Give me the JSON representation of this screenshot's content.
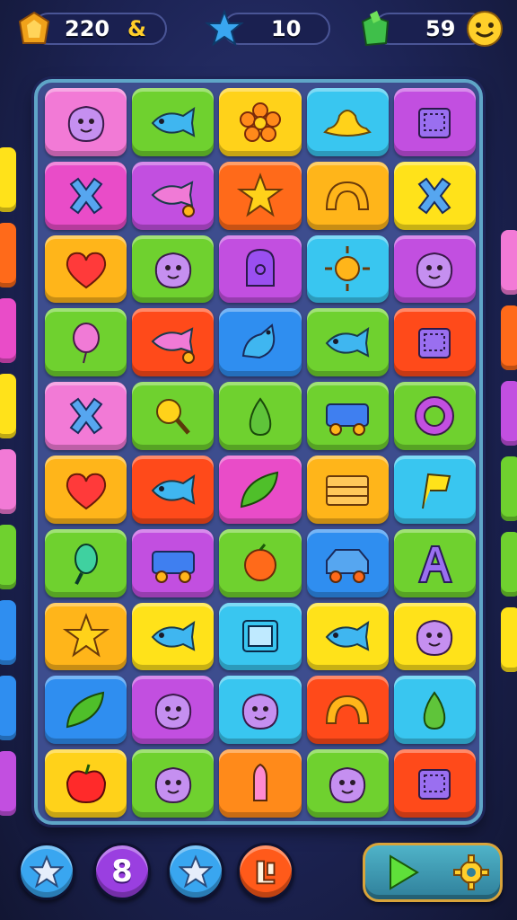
{
  "hud": {
    "coins": {
      "value": "220",
      "suffix": "&"
    },
    "stars": {
      "value": "10"
    },
    "moves": {
      "value": "59"
    }
  },
  "board": {
    "rows": [
      [
        {
          "color": "#f27ad6",
          "icon": "blob-face"
        },
        {
          "color": "#6fd12f",
          "icon": "fish"
        },
        {
          "color": "#ffd21a",
          "icon": "flower"
        },
        {
          "color": "#39c6f0",
          "icon": "hat"
        },
        {
          "color": "#c24fe0",
          "icon": "box"
        }
      ],
      [
        {
          "color": "#e94cc8",
          "icon": "cross"
        },
        {
          "color": "#c24fe0",
          "icon": "fish-cart"
        },
        {
          "color": "#ff6a1a",
          "icon": "star"
        },
        {
          "color": "#ffb51a",
          "icon": "rainbow"
        },
        {
          "color": "#ffe21a",
          "icon": "cross"
        }
      ],
      [
        {
          "color": "#ffb51a",
          "icon": "heart"
        },
        {
          "color": "#6fd12f",
          "icon": "blob-face"
        },
        {
          "color": "#c24fe0",
          "icon": "tombstone"
        },
        {
          "color": "#39c6f0",
          "icon": "sun"
        },
        {
          "color": "#c24fe0",
          "icon": "blob-face"
        }
      ],
      [
        {
          "color": "#6fd12f",
          "icon": "balloon"
        },
        {
          "color": "#ff4a1a",
          "icon": "fish-cart"
        },
        {
          "color": "#2f8ef0",
          "icon": "bird"
        },
        {
          "color": "#6fd12f",
          "icon": "fish"
        },
        {
          "color": "#ff4a1a",
          "icon": "box"
        }
      ],
      [
        {
          "color": "#f27ad6",
          "icon": "cross"
        },
        {
          "color": "#6fd12f",
          "icon": "magnifier"
        },
        {
          "color": "#6fd12f",
          "icon": "pear"
        },
        {
          "color": "#6fd12f",
          "icon": "cart"
        },
        {
          "color": "#6fd12f",
          "icon": "ring"
        }
      ],
      [
        {
          "color": "#ffb51a",
          "icon": "heart"
        },
        {
          "color": "#ff4a1a",
          "icon": "fish"
        },
        {
          "color": "#e94cc8",
          "icon": "leaf"
        },
        {
          "color": "#ffb51a",
          "icon": "crate"
        },
        {
          "color": "#39c6f0",
          "icon": "flag"
        }
      ],
      [
        {
          "color": "#6fd12f",
          "icon": "mirror"
        },
        {
          "color": "#c24fe0",
          "icon": "cart"
        },
        {
          "color": "#6fd12f",
          "icon": "orange"
        },
        {
          "color": "#2f8ef0",
          "icon": "car"
        },
        {
          "color": "#6fd12f",
          "icon": "letter-a"
        }
      ],
      [
        {
          "color": "#ffb51a",
          "icon": "star"
        },
        {
          "color": "#ffe21a",
          "icon": "fish"
        },
        {
          "color": "#39c6f0",
          "icon": "frame"
        },
        {
          "color": "#ffe21a",
          "icon": "fish"
        },
        {
          "color": "#ffe21a",
          "icon": "blob-face"
        }
      ],
      [
        {
          "color": "#2f8ef0",
          "icon": "leaf"
        },
        {
          "color": "#c24fe0",
          "icon": "blob-face"
        },
        {
          "color": "#39c6f0",
          "icon": "blob-face"
        },
        {
          "color": "#ff4a1a",
          "icon": "rainbow"
        },
        {
          "color": "#39c6f0",
          "icon": "pear"
        }
      ],
      [
        {
          "color": "#ffd21a",
          "icon": "apple"
        },
        {
          "color": "#6fd12f",
          "icon": "blob-face"
        },
        {
          "color": "#ff8a1a",
          "icon": "tube"
        },
        {
          "color": "#6fd12f",
          "icon": "blob-face"
        },
        {
          "color": "#ff4a1a",
          "icon": "box"
        }
      ]
    ]
  },
  "side_tiles": {
    "left": [
      "#ffe21a",
      "#ff6a1a",
      "#e94cc8",
      "#ffe21a",
      "#f27ad6",
      "#6fd12f",
      "#2f8ef0",
      "#2f8ef0",
      "#c24fe0"
    ],
    "right": [
      "#f27ad6",
      "#ff6a1a",
      "#c24fe0",
      "#6fd12f",
      "#6fd12f",
      "#ffe21a"
    ]
  },
  "bottom_bar": {
    "star_button_1": {
      "color": "#39a6f0"
    },
    "moves_counter": {
      "value": "8",
      "color": "#9a3fe0"
    },
    "star_button_2": {
      "color": "#39a6f0"
    },
    "booster_button": {
      "color": "#ff5a1a"
    }
  },
  "icon_names": {
    "coin": "coin-icon",
    "star": "star-icon",
    "bonus": "gift-icon",
    "smiley": "smiley-icon",
    "play": "play-icon",
    "settings": "gear-icon"
  }
}
